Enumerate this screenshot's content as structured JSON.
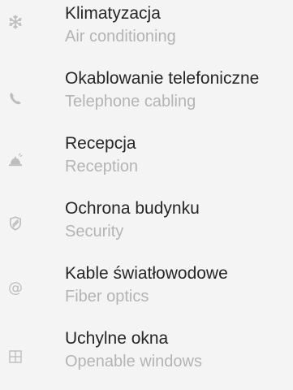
{
  "services": {
    "items": [
      {
        "title": "Klimatyzacja",
        "subtitle": "Air conditioning",
        "icon": "snowflake-icon"
      },
      {
        "title": "Okablowanie telefoniczne",
        "subtitle": "Telephone cabling",
        "icon": "phone-icon"
      },
      {
        "title": "Recepcja",
        "subtitle": "Reception",
        "icon": "reception-bell-icon"
      },
      {
        "title": "Ochrona budynku",
        "subtitle": "Security",
        "icon": "shield-icon"
      },
      {
        "title": "Kable światłowodowe",
        "subtitle": "Fiber optics",
        "icon": "at-sign-icon"
      },
      {
        "title": "Uchylne okna",
        "subtitle": "Openable windows",
        "icon": "window-icon"
      }
    ]
  },
  "colors": {
    "background": "#f4f4f4",
    "title": "#262626",
    "subtitle": "#b4b4b4",
    "icon": "#bdbdbd"
  }
}
